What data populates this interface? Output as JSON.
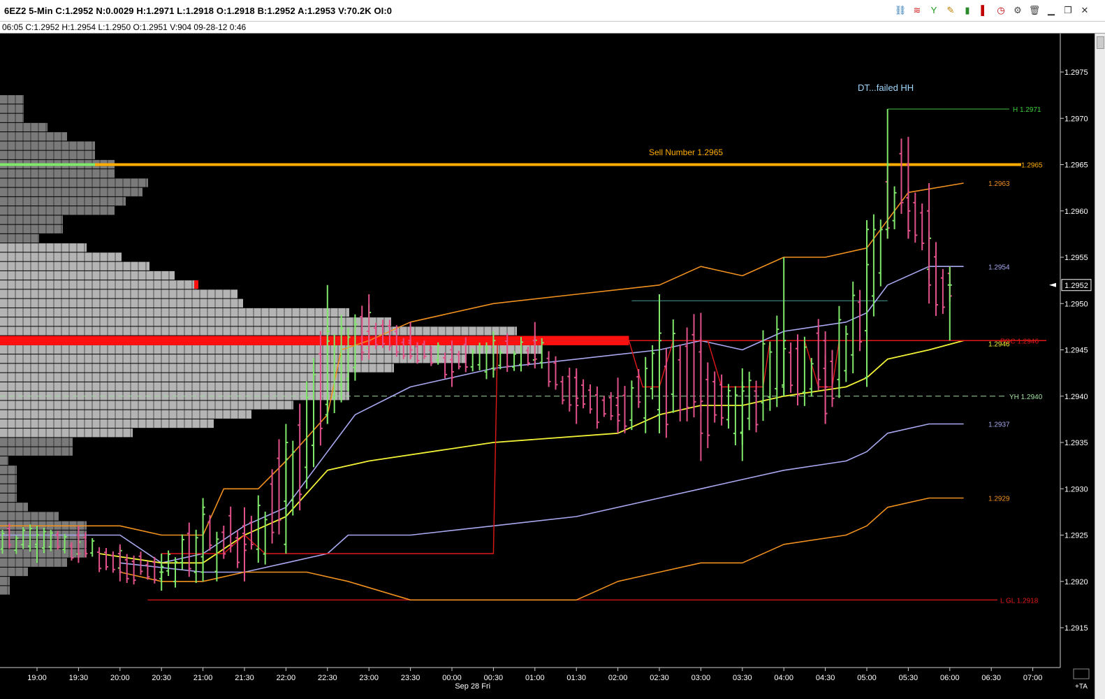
{
  "window": {
    "title": "6EZ2  5-Min  C:1.2952  N:0.0029  H:1.2971  L:1.2918  O:1.2918  B:1.2952  A:1.2953  V:70.2K  OI:0",
    "info_line": "06:05  C:1.2952  H:1.2954  L:1.2950  O:1.2951  V:904  09-28-12  0:46"
  },
  "toolbar": [
    {
      "name": "link-icon",
      "glyph": "⛓",
      "color": "#1f6fb0"
    },
    {
      "name": "chart-waves-icon",
      "glyph": "≋",
      "color": "#d02020"
    },
    {
      "name": "indicator-icon",
      "glyph": "Y",
      "color": "#1a9a1a"
    },
    {
      "name": "draw-pencil-icon",
      "glyph": "✎",
      "color": "#c08000"
    },
    {
      "name": "bar-chart-icon",
      "glyph": "▮",
      "color": "#2a8a2a"
    },
    {
      "name": "candle-icon",
      "glyph": "▌",
      "color": "#c00000"
    },
    {
      "name": "clock-icon",
      "glyph": "◷",
      "color": "#c00000"
    },
    {
      "name": "settings-icon",
      "glyph": "⚙",
      "color": "#444444"
    },
    {
      "name": "trash-icon",
      "glyph": "🗑",
      "color": "#444444"
    },
    {
      "name": "minimize-icon",
      "glyph": "▁",
      "color": "#333333"
    },
    {
      "name": "restore-icon",
      "glyph": "❐",
      "color": "#333333"
    },
    {
      "name": "close-icon",
      "glyph": "✕",
      "color": "#333333"
    }
  ],
  "colors": {
    "background": "#000000",
    "up_bar": "#7fe86a",
    "down_bar": "#e0508a",
    "vwap": "#a8a8f0",
    "band_outer": "#f0901e",
    "yellow_line": "#f2f236",
    "red_line": "#e01818",
    "sell_line": "#ffae00",
    "high_line": "#3a9a3a",
    "yh_line": "#a0d8a0",
    "profile_dark": "#7a7a7a",
    "profile_light": "#b4b4b4",
    "poc": "#ff1010",
    "axis_text": "#ffffff"
  },
  "annotations": {
    "dt_note": "DT...failed HH",
    "sell_number": "Sell Number 1.2965"
  },
  "line_labels": {
    "high": "H  1.2971",
    "sell": "1.2965",
    "upper_band": "1.2963",
    "vwap_upper": "1.2954",
    "poc": "POC  1.2946",
    "yellow_right": "1.2946",
    "yh": "YH  1.2940",
    "vwap_lower": "1.2937",
    "lower_band": "1.2929",
    "low": "L  GL  1.2918"
  },
  "current_price": "1.2952",
  "plus_ta": "+TA",
  "chart_data": {
    "type": "bar",
    "ylim": [
      1.2911,
      1.2981
    ],
    "y_ticks": [
      1.2915,
      1.292,
      1.2925,
      1.293,
      1.2935,
      1.294,
      1.2945,
      1.295,
      1.2955,
      1.296,
      1.2965,
      1.297,
      1.2975
    ],
    "x_ticks": [
      "19:00",
      "19:30",
      "20:00",
      "20:30",
      "21:00",
      "21:30",
      "22:00",
      "22:30",
      "23:00",
      "23:30",
      "00:00",
      "00:30",
      "01:00",
      "01:30",
      "02:00",
      "02:30",
      "03:00",
      "03:30",
      "04:00",
      "04:30",
      "05:00",
      "05:30",
      "06:00",
      "06:30",
      "07:00"
    ],
    "date_label": "Sep 28 Fri",
    "levels": {
      "high": 1.2971,
      "sell": 1.2965,
      "upper_band": 1.2963,
      "vwap_upper": 1.2954,
      "poc": 1.2946,
      "yh": 1.294,
      "vwap_lower": 1.2937,
      "lower_band": 1.2929,
      "low": 1.2918
    },
    "bars": [
      {
        "t": "18:25",
        "o": 1.2925,
        "h": 1.2927,
        "l": 1.2923,
        "c": 1.2924
      },
      {
        "t": "19:00",
        "o": 1.2924,
        "h": 1.2926,
        "l": 1.2922,
        "c": 1.2925
      },
      {
        "t": "19:30",
        "o": 1.2925,
        "h": 1.2926,
        "l": 1.2922,
        "c": 1.2923
      },
      {
        "t": "20:00",
        "o": 1.2923,
        "h": 1.2924,
        "l": 1.292,
        "c": 1.2921
      },
      {
        "t": "20:30",
        "o": 1.2921,
        "h": 1.2923,
        "l": 1.2919,
        "c": 1.2921
      },
      {
        "t": "21:00",
        "o": 1.2921,
        "h": 1.2929,
        "l": 1.292,
        "c": 1.2928
      },
      {
        "t": "21:30",
        "o": 1.2926,
        "h": 1.2928,
        "l": 1.292,
        "c": 1.2924
      },
      {
        "t": "22:00",
        "o": 1.2924,
        "h": 1.2937,
        "l": 1.2923,
        "c": 1.2935
      },
      {
        "t": "22:30",
        "o": 1.2938,
        "h": 1.2952,
        "l": 1.2937,
        "c": 1.2947
      },
      {
        "t": "23:00",
        "o": 1.2947,
        "h": 1.2951,
        "l": 1.2944,
        "c": 1.2946
      },
      {
        "t": "23:30",
        "o": 1.2946,
        "h": 1.2948,
        "l": 1.2944,
        "c": 1.2945
      },
      {
        "t": "00:00",
        "o": 1.2945,
        "h": 1.2946,
        "l": 1.2941,
        "c": 1.2942
      },
      {
        "t": "00:30",
        "o": 1.2943,
        "h": 1.2947,
        "l": 1.2942,
        "c": 1.2946
      },
      {
        "t": "01:00",
        "o": 1.2946,
        "h": 1.2948,
        "l": 1.2943,
        "c": 1.2944
      },
      {
        "t": "01:30",
        "o": 1.2942,
        "h": 1.2943,
        "l": 1.2937,
        "c": 1.2939
      },
      {
        "t": "02:00",
        "o": 1.2939,
        "h": 1.2942,
        "l": 1.2936,
        "c": 1.2938
      },
      {
        "t": "02:30",
        "o": 1.2938,
        "h": 1.2951,
        "l": 1.2936,
        "c": 1.2946
      },
      {
        "t": "03:00",
        "o": 1.2946,
        "h": 1.2949,
        "l": 1.2933,
        "c": 1.2936
      },
      {
        "t": "03:30",
        "o": 1.2936,
        "h": 1.2943,
        "l": 1.2933,
        "c": 1.2941
      },
      {
        "t": "04:00",
        "o": 1.2941,
        "h": 1.2955,
        "l": 1.294,
        "c": 1.2946
      },
      {
        "t": "04:30",
        "o": 1.2946,
        "h": 1.2947,
        "l": 1.2937,
        "c": 1.2941
      },
      {
        "t": "05:00",
        "o": 1.2942,
        "h": 1.2959,
        "l": 1.2941,
        "c": 1.2958
      },
      {
        "t": "05:15",
        "o": 1.2958,
        "h": 1.2971,
        "l": 1.2957,
        "c": 1.2965
      },
      {
        "t": "05:30",
        "o": 1.2965,
        "h": 1.2968,
        "l": 1.2957,
        "c": 1.296
      },
      {
        "t": "05:45",
        "o": 1.296,
        "h": 1.2963,
        "l": 1.295,
        "c": 1.2952
      },
      {
        "t": "06:00",
        "o": 1.2952,
        "h": 1.2954,
        "l": 1.2946,
        "c": 1.2952
      }
    ]
  }
}
